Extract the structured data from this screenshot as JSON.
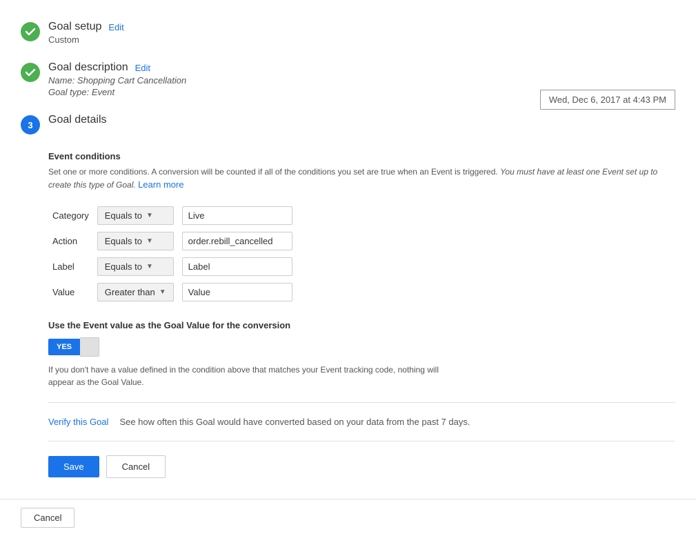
{
  "datetime": "Wed, Dec 6, 2017 at 4:43 PM",
  "steps": {
    "goal_setup": {
      "title": "Goal setup",
      "edit_label": "Edit",
      "sub": "Custom"
    },
    "goal_description": {
      "title": "Goal description",
      "edit_label": "Edit",
      "name_label": "Name:",
      "name_value": "Shopping Cart Cancellation",
      "type_label": "Goal type:",
      "type_value": "Event"
    },
    "goal_details": {
      "title": "Goal details",
      "number": "3"
    }
  },
  "event_conditions": {
    "title": "Event conditions",
    "description": "Set one or more conditions. A conversion will be counted if all of the conditions you set are true when an Event is triggered.",
    "description_italic": "You must have at least one Event set up to create this type of Goal.",
    "learn_more": "Learn more",
    "rows": [
      {
        "label": "Category",
        "condition": "Equals to",
        "value": "Live"
      },
      {
        "label": "Action",
        "condition": "Equals to",
        "value": "order.rebill_cancelled"
      },
      {
        "label": "Label",
        "condition": "Equals to",
        "value": "Label"
      },
      {
        "label": "Value",
        "condition": "Greater than",
        "value": "Value"
      }
    ]
  },
  "toggle_section": {
    "label": "Use the Event value as the Goal Value for the conversion",
    "yes_label": "YES",
    "note": "If you don't have a value defined in the condition above that matches your Event tracking code, nothing will appear as the Goal Value."
  },
  "verify": {
    "link_text": "Verify this Goal",
    "description": "See how often this Goal would have converted based on your data from the past 7 days."
  },
  "actions": {
    "save_label": "Save",
    "cancel_label": "Cancel",
    "cancel_bottom_label": "Cancel"
  }
}
